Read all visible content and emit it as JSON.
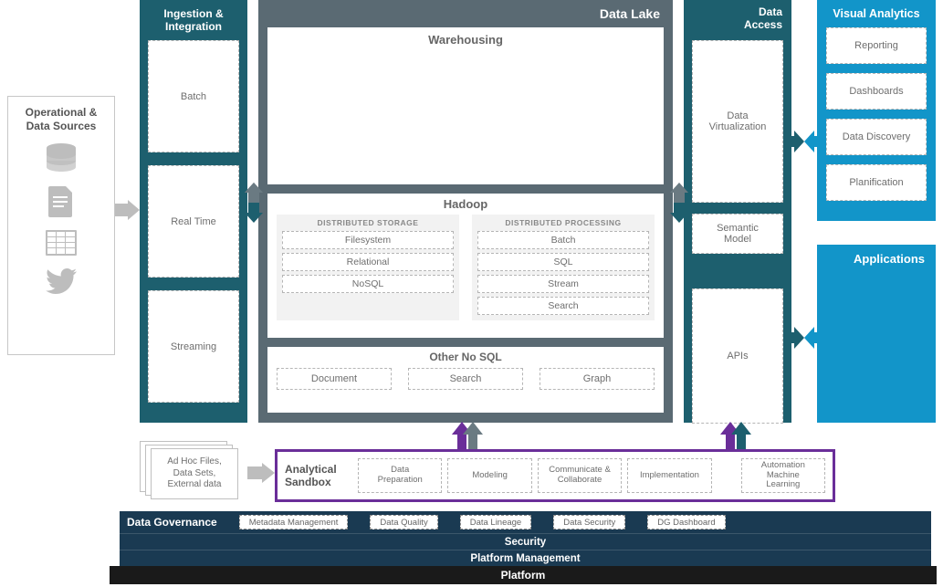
{
  "operational_sources": {
    "title": "Operational &\nData Sources"
  },
  "ingestion": {
    "title": "Ingestion &\nIntegration",
    "items": [
      "Batch",
      "Real Time",
      "Streaming"
    ]
  },
  "data_lake": {
    "title": "Data Lake",
    "warehousing": "Warehousing",
    "hadoop": {
      "title": "Hadoop",
      "storage_label": "DISTRIBUTED STORAGE",
      "storage": [
        "Filesystem",
        "Relational",
        "NoSQL"
      ],
      "processing_label": "DISTRIBUTED PROCESSING",
      "processing": [
        "Batch",
        "SQL",
        "Stream",
        "Search"
      ]
    },
    "other_nosql": {
      "title": "Other No SQL",
      "items": [
        "Document",
        "Search",
        "Graph"
      ]
    }
  },
  "data_access": {
    "title": "Data\nAccess",
    "virtualization": "Data\nVirtualization",
    "semantic": "Semantic\nModel",
    "apis": "APIs"
  },
  "visual_analytics": {
    "title": "Visual Analytics",
    "items": [
      "Reporting",
      "Dashboards",
      "Data Discovery",
      "Planification"
    ]
  },
  "applications": {
    "title": "Applications"
  },
  "adhoc": "Ad Hoc Files,\nData Sets,\nExternal data",
  "sandbox": {
    "title": "Analytical\nSandbox",
    "steps": [
      "Data\nPreparation",
      "Modeling",
      "Communicate &\nCollaborate",
      "Implementation"
    ],
    "automation": "Automation\nMachine\nLearning"
  },
  "governance": {
    "title": "Data Governance",
    "items": [
      "Metadata Management",
      "Data Quality",
      "Data Lineage",
      "Data Security",
      "DG Dashboard"
    ]
  },
  "security": "Security",
  "platform_mgmt": "Platform Management",
  "platform": "Platform"
}
